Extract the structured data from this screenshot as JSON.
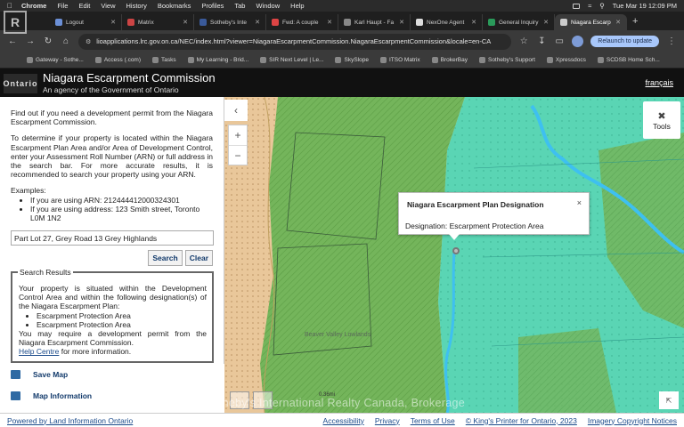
{
  "menubar": {
    "app": "Chrome",
    "items": [
      "File",
      "Edit",
      "View",
      "History",
      "Bookmarks",
      "Profiles",
      "Tab",
      "Window",
      "Help"
    ],
    "datetime": "Tue Mar 19  12:09 PM"
  },
  "tabs": [
    {
      "label": "Logout",
      "color": "#6b8fd6"
    },
    {
      "label": "Matrix",
      "color": "#c44"
    },
    {
      "label": "Sotheby's Inte",
      "color": "#3a5a9a"
    },
    {
      "label": "Fwd: A couple",
      "color": "#d44"
    },
    {
      "label": "Karl Haupt - Fa",
      "color": "#888"
    },
    {
      "label": "NexOne Agent",
      "color": "#ddd"
    },
    {
      "label": "General Inquiry",
      "color": "#2a9a5a"
    },
    {
      "label": "Niagara Escarp",
      "color": "#ccc",
      "active": true
    }
  ],
  "address": {
    "url": "lioapplications.lrc.gov.on.ca/NEC/index.html?viewer=NiagaraEscarpmentCommission.NiagaraEscarpmentCommission&locale=en-CA",
    "relaunch": "Relaunch to update"
  },
  "bookmarks": [
    "Gateway - Sothe...",
    "Access (.com)",
    "Tasks",
    "My Learning - Brid...",
    "SIR Next Level | Le...",
    "SkySlope",
    "ITSO Matrix",
    "BrokerBay",
    "Sotheby's Support",
    "Xpressdocs",
    "SCDSB Home Sch..."
  ],
  "site": {
    "logo": "Ontario",
    "title": "Niagara Escarpment Commission",
    "subtitle": "An agency of the Government of Ontario",
    "language": "français"
  },
  "panel": {
    "intro": "Find out if you need a development permit from the Niagara Escarpment Commission.",
    "instructions": "To determine if your property is located within the Niagara Escarpment Plan Area and/or Area of Development Control, enter your Assessment Roll Number (ARN) or full address in the search bar. For more accurate results, it is recommended to search your property using your ARN.",
    "examples_label": "Examples:",
    "examples": [
      "If you are using ARN: 212444412000324301",
      "If you are using address: 123 Smith street, Toronto L0M 1N2"
    ],
    "search_value": "Part Lot 27, Grey Road 13 Grey Highlands",
    "search_button": "Search",
    "clear_button": "Clear",
    "results_title": "Search Results",
    "results_text": "Your property is situated within the Development Control Area and within the following designation(s) of the Niagara Escarpment Plan:",
    "designations": [
      "Escarpment Protection Area",
      "Escarpment Protection Area"
    ],
    "permit_text": "You may require a development permit from the Niagara Escarpment Commission.",
    "help_link": "Help Centre",
    "help_suffix": " for more information.",
    "save_map": "Save Map",
    "map_information": "Map Information"
  },
  "map": {
    "tools": "Tools",
    "popup_title": "Niagara Escarpment Plan Designation",
    "popup_close": "×",
    "popup_body": "Designation: Escarpment Protection Area",
    "place_label": "Beaver Valley Lowlands",
    "scale": "0.36mi",
    "watermark": "Sotheby's International Realty Canada, Brokerage"
  },
  "footer": {
    "powered_by": "Powered by Land Information Ontario",
    "links": [
      "Accessibility",
      "Privacy",
      "Terms of Use",
      "© King's Printer for Ontario, 2023",
      "Imagery Copyright Notices"
    ]
  }
}
